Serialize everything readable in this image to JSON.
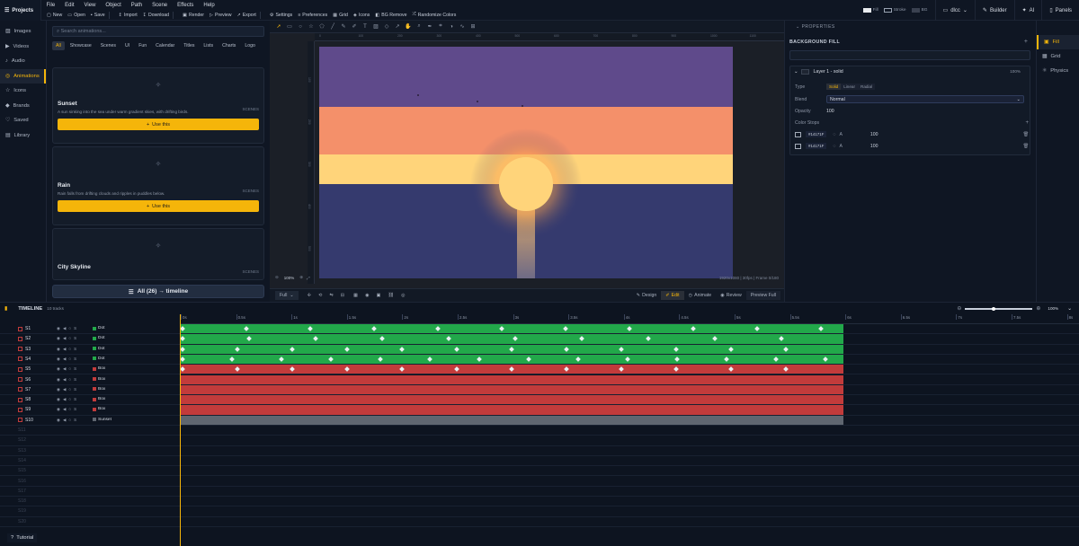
{
  "app": {
    "projects_label": "Projects"
  },
  "menu": [
    "File",
    "Edit",
    "View",
    "Object",
    "Path",
    "Scene",
    "Effects",
    "Help"
  ],
  "toolbar": [
    "New",
    "Open",
    "Save",
    "Import",
    "Download",
    "Render",
    "Preview",
    "Export",
    "Settings",
    "Preferences",
    "Grid",
    "Icons",
    "BG Remove",
    "Randomize Colors"
  ],
  "topright": {
    "color_fill_label": "Fill",
    "color_stroke_label": "Stroke",
    "bg_label": "BG",
    "user": "dlcc",
    "builder": "Builder",
    "ai": "AI",
    "panels": "Panels"
  },
  "sidebar": [
    {
      "label": "Images",
      "icon": "image-icon"
    },
    {
      "label": "Videos",
      "icon": "video-icon"
    },
    {
      "label": "Audio",
      "icon": "audio-icon"
    },
    {
      "label": "Animations",
      "icon": "animation-icon",
      "active": true
    },
    {
      "label": "Icons",
      "icon": "icons-icon"
    },
    {
      "label": "Brands",
      "icon": "brand-icon"
    },
    {
      "label": "Saved",
      "icon": "saved-icon"
    },
    {
      "label": "Library",
      "icon": "library-icon"
    }
  ],
  "animations": {
    "search_placeholder": "Search animations...",
    "filters": [
      "All",
      "Showcase",
      "Scenes",
      "UI",
      "Fun",
      "Calendar",
      "Titles",
      "Lists",
      "Charts",
      "Logo"
    ],
    "cards": [
      {
        "title": "Sunset",
        "tag": "SCENES",
        "desc": "A sun sinking into the sea under warm gradient skies, with drifting birds.",
        "button": "Use this"
      },
      {
        "title": "Rain",
        "tag": "SCENES",
        "desc": "Rain falls from drifting clouds and ripples in puddles below.",
        "button": "Use this"
      },
      {
        "title": "City Skyline",
        "tag": "SCENES",
        "desc": "",
        "button": "Use this"
      }
    ],
    "all_button": "All (26) → timeline"
  },
  "canvas": {
    "ruler_top": [
      "0",
      "100",
      "200",
      "300",
      "400",
      "500",
      "600",
      "700",
      "800",
      "900",
      "1000",
      "1100",
      "1200"
    ],
    "ruler_left": [
      "100",
      "200",
      "300",
      "400",
      "500",
      "600"
    ],
    "zoom": "100%",
    "status": "1920x1080  |  30fps  |  Frame 0/180",
    "view": "Full",
    "modes": [
      "Design",
      "Edit",
      "Animate",
      "Review"
    ],
    "preview": "Preview Full",
    "scene_colors": {
      "sky_top": "#5f4a8b",
      "sky_mid": "#f4906a",
      "horizon": "#ffd47a",
      "sea": "#353a6e",
      "sun": "#ffd47a"
    }
  },
  "properties": {
    "title": "PROPERTIES",
    "section": "BACKGROUND FILL",
    "layer": "Layer 1 - solid",
    "layer_pct": "100%",
    "type_label": "Type",
    "types": [
      "Solid",
      "Linear",
      "Radial"
    ],
    "blend_label": "Blend",
    "blend_value": "Normal",
    "opacity_label": "Opacity",
    "opacity_value": "100",
    "stops_label": "Color Stops",
    "stops": [
      {
        "hex": "#14171F",
        "a": "A",
        "val": "100"
      },
      {
        "hex": "#14171F",
        "a": "A",
        "val": "100"
      }
    ],
    "side_tabs": [
      "Fill",
      "Grid",
      "Physics"
    ]
  },
  "timeline": {
    "title": "TIMELINE",
    "count": "10 tracks",
    "zoom": "100%",
    "ticks": [
      "0s",
      "0.5s",
      "1s",
      "1.5s",
      "2s",
      "2.5s",
      "3s",
      "3.5s",
      "4s",
      "4.5s",
      "5s",
      "5.5s",
      "6s",
      "6.5s",
      "7s",
      "7.5s",
      "8s"
    ],
    "tracks": [
      {
        "id": "S1",
        "type": "Dot",
        "color": "green"
      },
      {
        "id": "S2",
        "type": "Dot",
        "color": "green"
      },
      {
        "id": "S3",
        "type": "Dot",
        "color": "green"
      },
      {
        "id": "S4",
        "type": "Dot",
        "color": "green"
      },
      {
        "id": "S5",
        "type": "Box",
        "color": "red"
      },
      {
        "id": "S6",
        "type": "Box",
        "color": "red"
      },
      {
        "id": "S7",
        "type": "Box",
        "color": "red"
      },
      {
        "id": "S8",
        "type": "Box",
        "color": "red"
      },
      {
        "id": "S9",
        "type": "Box",
        "color": "red"
      },
      {
        "id": "S10",
        "type": "Sunset",
        "color": "gray"
      }
    ],
    "empty_rows": [
      "S11",
      "S12",
      "S13",
      "S14",
      "S15",
      "S16",
      "S17",
      "S18",
      "S19",
      "S20"
    ],
    "tutorial": "Tutorial"
  },
  "colors": {
    "accent": "#f5b50a",
    "green": "#22a84a",
    "red": "#c23b3b",
    "gray": "#5f6670"
  }
}
